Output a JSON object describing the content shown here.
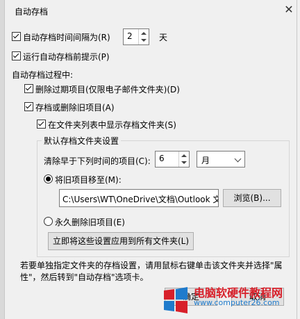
{
  "dialog": {
    "title": "自动存档",
    "close_symbol": "✕"
  },
  "autosave_every": {
    "label": "自动存档时间间隔为(R)",
    "value": "2",
    "unit": "天",
    "checked": true
  },
  "prompt_before": {
    "label": "运行自动存档前提示(P)",
    "checked": true
  },
  "during_label": "自动存档过程中:",
  "delete_expired": {
    "label": "删除过期项目(仅限电子邮件文件夹)(D)",
    "checked": true
  },
  "archive_or_delete": {
    "label": "存档或删除旧项目(A)",
    "checked": true
  },
  "show_in_list": {
    "label": "在文件夹列表中显示存档文件夹(S)",
    "checked": true
  },
  "defaults_group": {
    "title": "默认存档文件夹设置",
    "clean_older_label": "清除早于下列时间的项目(C):",
    "clean_older_value": "6",
    "clean_older_unit": "月",
    "move_old": {
      "label": "将旧项目移至(M):",
      "selected": true
    },
    "path_value": "C:\\Users\\WT\\OneDrive\\文档\\Outlook 文件",
    "browse_label": "浏览(B)...",
    "permanently_delete": {
      "label": "永久删除旧项目(E)",
      "selected": false
    },
    "apply_all_label": "立即将这些设置应用到所有文件夹(L)"
  },
  "description": "若要单独指定文件夹的存档设置，请用鼠标右键单击该文件夹并选择\"属性\"，然后转到\"自动存档\"选项卡。",
  "footer": {
    "ok_label": "确定",
    "cancel_label": "取消"
  },
  "watermark": {
    "site_name": "电脑软硬件教程网",
    "url": "www.computer26.com"
  },
  "colors": {
    "dialog_bg": "#f0f0f0",
    "watermark_red": "#d8202a",
    "watermark_blue": "#1f7bcc"
  }
}
